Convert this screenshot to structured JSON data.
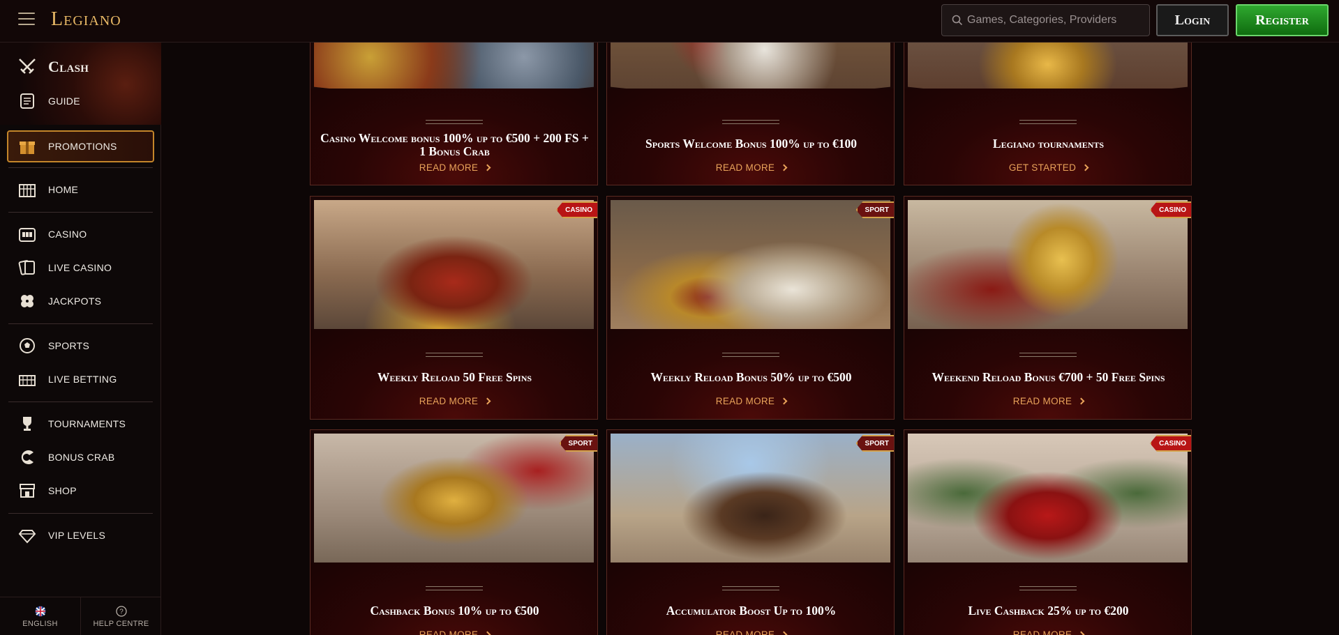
{
  "header": {
    "logo": "Legiano",
    "search_placeholder": "Games, Categories, Providers",
    "login_label": "Login",
    "register_label": "Register"
  },
  "sidebar": {
    "clash": "Clash",
    "guide": "GUIDE",
    "promotions": "PROMOTIONS",
    "home": "HOME",
    "casino": "CASINO",
    "live_casino": "LIVE CASINO",
    "jackpots": "JACKPOTS",
    "sports": "SPORTS",
    "live_betting": "LIVE BETTING",
    "tournaments": "TOURNAMENTS",
    "bonus_crab": "BONUS CRAB",
    "shop": "SHOP",
    "vip_levels": "VIP LEVELS",
    "language": "ENGLISH",
    "help": "HELP CENTRE"
  },
  "promos": [
    {
      "title": "Casino Welcome bonus 100% up to €500 + 200 FS + 1 Bonus Crab",
      "cta": "READ MORE",
      "badge": ""
    },
    {
      "title": "Sports Welcome Bonus 100% up to €100",
      "cta": "READ MORE",
      "badge": ""
    },
    {
      "title": "Legiano tournaments",
      "cta": "GET STARTED",
      "badge": ""
    },
    {
      "title": "Weekly Reload 50 Free Spins",
      "cta": "READ MORE",
      "badge": "CASINO"
    },
    {
      "title": "Weekly Reload Bonus 50% up to €500",
      "cta": "READ MORE",
      "badge": "SPORT"
    },
    {
      "title": "Weekend Reload Bonus €700 + 50 Free Spins",
      "cta": "READ MORE",
      "badge": "CASINO"
    },
    {
      "title": "Cashback Bonus 10% up to €500",
      "cta": "READ MORE",
      "badge": "SPORT"
    },
    {
      "title": "Accumulator Boost Up to 100%",
      "cta": "READ MORE",
      "badge": "SPORT"
    },
    {
      "title": "Live Cashback 25% up to €200",
      "cta": "READ MORE",
      "badge": "CASINO"
    }
  ],
  "colors": {
    "accent_gold": "#e9b966",
    "cta_orange": "#e9a35a",
    "register_green": "#1f8f1f",
    "badge_red": "#b81515"
  }
}
